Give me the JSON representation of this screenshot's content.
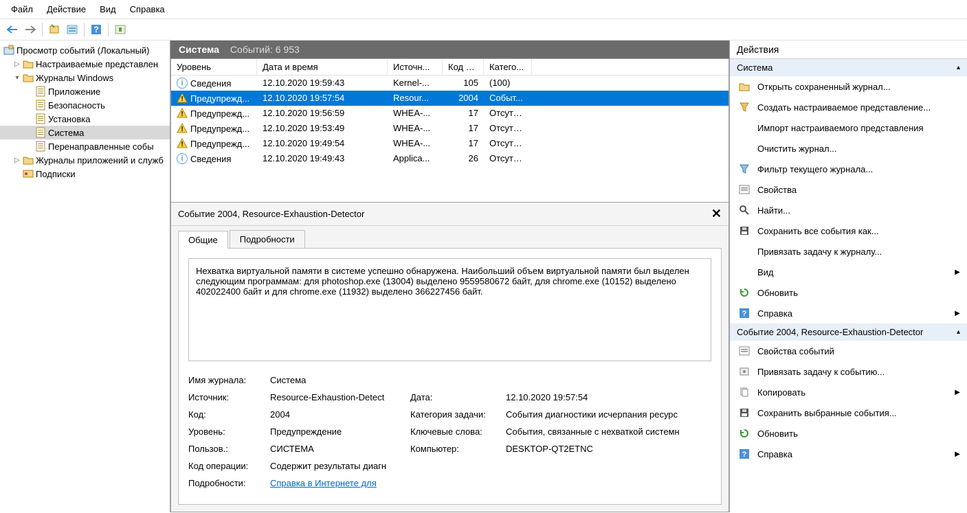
{
  "menu": {
    "file": "Файл",
    "action": "Действие",
    "view": "Вид",
    "help": "Справка"
  },
  "tree": {
    "root": "Просмотр событий (Локальный)",
    "custom_views": "Настраиваемые представлен",
    "windows_logs": "Журналы Windows",
    "app": "Приложение",
    "security": "Безопасность",
    "setup": "Установка",
    "system": "Система",
    "forwarded": "Перенаправленные собы",
    "app_services": "Журналы приложений и служб",
    "subscriptions": "Подписки"
  },
  "center_header": {
    "title": "Система",
    "count": "Событий: 6 953"
  },
  "columns": {
    "level": "Уровень",
    "date": "Дата и время",
    "source": "Источн...",
    "code": "Код со...",
    "category": "Катего..."
  },
  "level_labels": {
    "info": "Сведения",
    "warn": "Предупрежд..."
  },
  "events": [
    {
      "type": "info",
      "date": "12.10.2020 19:59:43",
      "source": "Kernel-...",
      "code": "105",
      "category": "(100)"
    },
    {
      "type": "warn",
      "date": "12.10.2020 19:57:54",
      "source": "Resour...",
      "code": "2004",
      "category": "Событ...",
      "selected": true
    },
    {
      "type": "warn",
      "date": "12.10.2020 19:56:59",
      "source": "WHEA-...",
      "code": "17",
      "category": "Отсутст..."
    },
    {
      "type": "warn",
      "date": "12.10.2020 19:53:49",
      "source": "WHEA-...",
      "code": "17",
      "category": "Отсутст..."
    },
    {
      "type": "warn",
      "date": "12.10.2020 19:49:54",
      "source": "WHEA-...",
      "code": "17",
      "category": "Отсутст..."
    },
    {
      "type": "info",
      "date": "12.10.2020 19:49:43",
      "source": "Applica...",
      "code": "26",
      "category": "Отсутст..."
    }
  ],
  "detail": {
    "title": "Событие 2004, Resource-Exhaustion-Detector",
    "tab_general": "Общие",
    "tab_details": "Подробности",
    "message": "Нехватка виртуальной памяти в системе успешно обнаружена. Наибольший объем виртуальной памяти был выделен следующим программам: для photoshop.exe (13004) выделено 9559580672 байт, для chrome.exe (10152) выделено 402022400 байт и для chrome.exe (11932) выделено 366227456 байт.",
    "labels": {
      "log_name": "Имя журнала:",
      "source": "Источник:",
      "code": "Код:",
      "level": "Уровень:",
      "user": "Пользов.:",
      "opcode": "Код операции:",
      "more": "Подробности:",
      "date": "Дата:",
      "task_cat": "Категория задачи:",
      "keywords": "Ключевые слова:",
      "computer": "Компьютер:"
    },
    "values": {
      "log_name": "Система",
      "source": "Resource-Exhaustion-Detect",
      "code": "2004",
      "level": "Предупреждение",
      "user": "СИСТЕМА",
      "opcode": "Содержит результаты диагн",
      "more_link": "Справка в Интернете для ",
      "date": "12.10.2020 19:57:54",
      "task_cat": "События диагностики исчерпания ресурс",
      "keywords": "События, связанные с нехваткой системн",
      "computer": "DESKTOP-QT2ETNC"
    }
  },
  "actions": {
    "panel_title": "Действия",
    "section1_title": "Система",
    "open_saved": "Открыть сохраненный журнал...",
    "create_custom": "Создать настраиваемое представление...",
    "import_custom": "Импорт настраиваемого представления",
    "clear_log": "Очистить журнал...",
    "filter_log": "Фильтр текущего журнала...",
    "properties": "Свойства",
    "find": "Найти...",
    "save_all": "Сохранить все события как...",
    "attach_task": "Привязать задачу к журналу...",
    "view": "Вид",
    "refresh": "Обновить",
    "help": "Справка",
    "section2_title": "Событие 2004, Resource-Exhaustion-Detector",
    "event_props": "Свойства событий",
    "attach_task_event": "Привязать задачу к событию...",
    "copy": "Копировать",
    "save_selected": "Сохранить выбранные события...",
    "refresh2": "Обновить",
    "help2": "Справка"
  }
}
